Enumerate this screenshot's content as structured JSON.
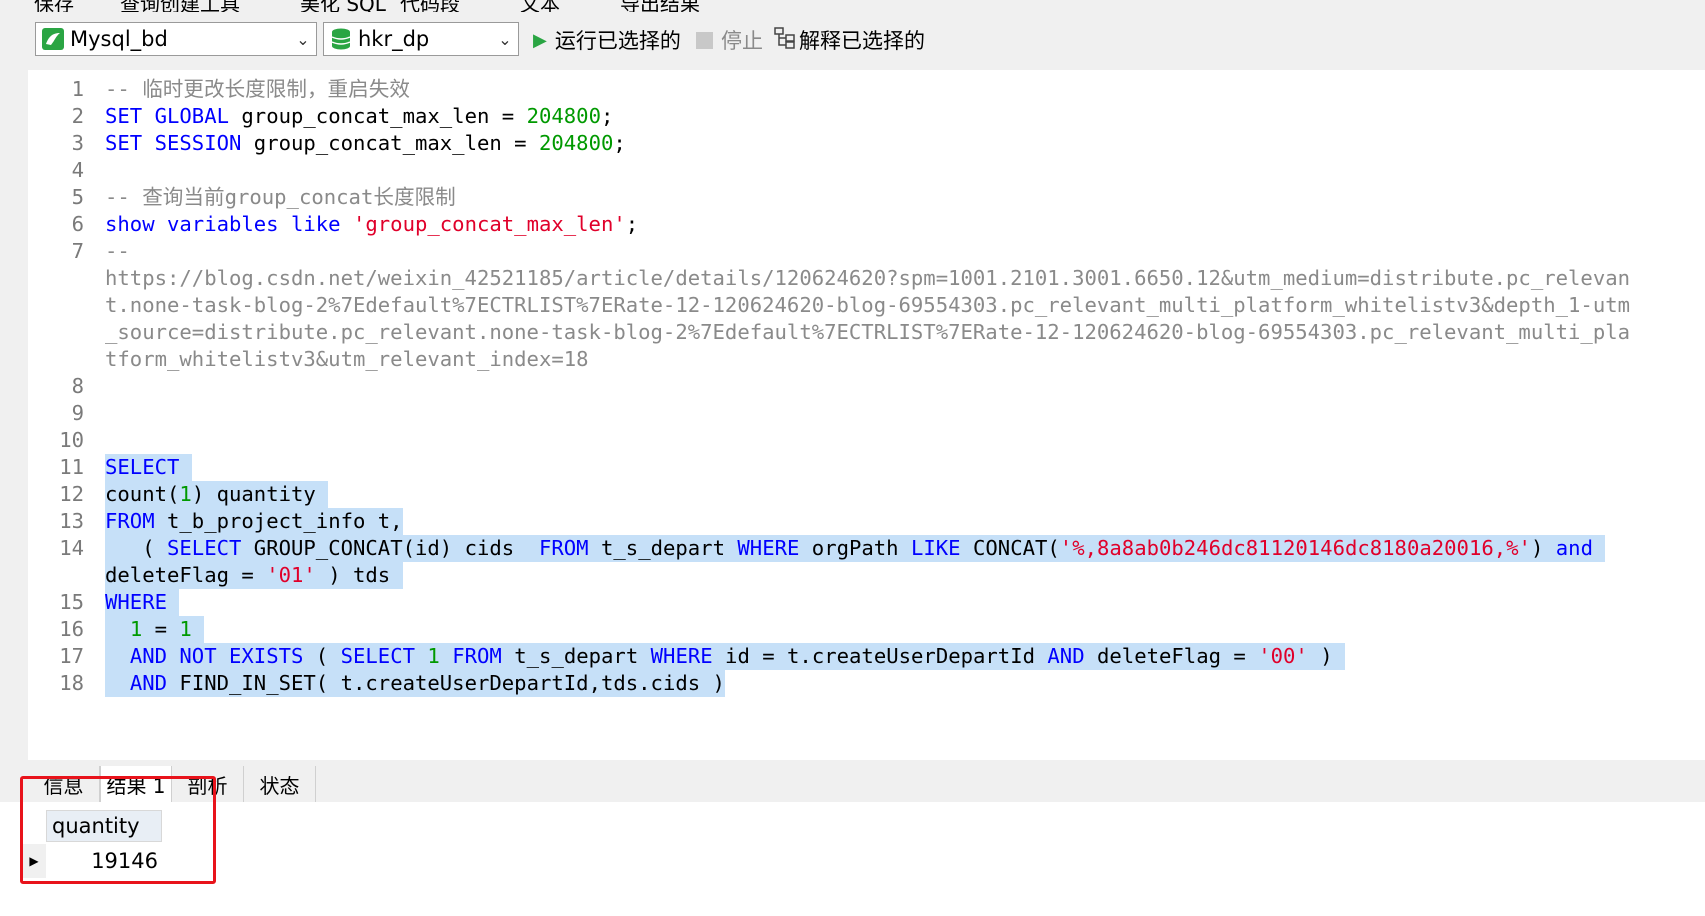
{
  "top_partial": {
    "items": [
      "保存",
      "查询创建工具",
      "美化 SQL",
      "代码段",
      "文本",
      "导出结果"
    ]
  },
  "toolbar": {
    "connection": "Mysql_bd",
    "database": "hkr_dp",
    "run_selected": "运行已选择的",
    "stop": "停止",
    "explain_selected": "解释已选择的"
  },
  "editor": {
    "lines": [
      {
        "n": "1",
        "tokens": [
          {
            "t": "-- 临时更改长度限制，重启失效",
            "c": "cm"
          }
        ]
      },
      {
        "n": "2",
        "tokens": [
          {
            "t": "SET GLOBAL",
            "c": "kw"
          },
          {
            "t": " group_concat_max_len = ",
            "c": ""
          },
          {
            "t": "204800",
            "c": "num"
          },
          {
            "t": ";",
            "c": ""
          }
        ]
      },
      {
        "n": "3",
        "tokens": [
          {
            "t": "SET SESSION",
            "c": "kw"
          },
          {
            "t": " group_concat_max_len = ",
            "c": ""
          },
          {
            "t": "204800",
            "c": "num"
          },
          {
            "t": ";",
            "c": ""
          }
        ]
      },
      {
        "n": "4",
        "tokens": []
      },
      {
        "n": "5",
        "tokens": [
          {
            "t": "-- 查询当前group_concat长度限制",
            "c": "cm"
          }
        ]
      },
      {
        "n": "6",
        "tokens": [
          {
            "t": "show variables like",
            "c": "kw"
          },
          {
            "t": " ",
            "c": ""
          },
          {
            "t": "'group_concat_max_len'",
            "c": "str"
          },
          {
            "t": ";",
            "c": ""
          }
        ]
      },
      {
        "n": "7",
        "tokens": [
          {
            "t": "--",
            "c": "cm"
          }
        ]
      },
      {
        "n": "",
        "tokens": [
          {
            "t": "https://blog.csdn.net/weixin_42521185/article/details/120624620?spm=1001.2101.3001.6650.12&utm_medium=distribute.pc_relevan",
            "c": "cm"
          }
        ]
      },
      {
        "n": "",
        "tokens": [
          {
            "t": "t.none-task-blog-2%7Edefault%7ECTRLIST%7ERate-12-120624620-blog-69554303.pc_relevant_multi_platform_whitelistv3&depth_1-utm",
            "c": "cm"
          }
        ]
      },
      {
        "n": "",
        "tokens": [
          {
            "t": "_source=distribute.pc_relevant.none-task-blog-2%7Edefault%7ECTRLIST%7ERate-12-120624620-blog-69554303.pc_relevant_multi_pla",
            "c": "cm"
          }
        ]
      },
      {
        "n": "",
        "tokens": [
          {
            "t": "tform_whitelistv3&utm_relevant_index=18",
            "c": "cm"
          }
        ]
      },
      {
        "n": "8",
        "tokens": []
      },
      {
        "n": "9",
        "tokens": []
      },
      {
        "n": "10",
        "tokens": []
      },
      {
        "n": "11",
        "sel": true,
        "tokens": [
          {
            "t": "SELECT ",
            "c": "kw"
          }
        ]
      },
      {
        "n": "12",
        "sel": true,
        "tokens": [
          {
            "t": "count(",
            "c": ""
          },
          {
            "t": "1",
            "c": "num"
          },
          {
            "t": ") quantity ",
            "c": ""
          }
        ]
      },
      {
        "n": "13",
        "sel": true,
        "tokens": [
          {
            "t": "FROM",
            "c": "kw"
          },
          {
            "t": " t_b_project_info t,",
            "c": ""
          }
        ]
      },
      {
        "n": "14",
        "sel": true,
        "tokens": [
          {
            "t": "   ( ",
            "c": ""
          },
          {
            "t": "SELECT",
            "c": "kw"
          },
          {
            "t": " GROUP_CONCAT(id) cids  ",
            "c": ""
          },
          {
            "t": "FROM",
            "c": "kw"
          },
          {
            "t": " t_s_depart ",
            "c": ""
          },
          {
            "t": "WHERE",
            "c": "kw"
          },
          {
            "t": " orgPath ",
            "c": ""
          },
          {
            "t": "LIKE",
            "c": "kw"
          },
          {
            "t": " CONCAT(",
            "c": ""
          },
          {
            "t": "'%,8a8ab0b246dc81120146dc8180a20016,%'",
            "c": "str"
          },
          {
            "t": ") ",
            "c": ""
          },
          {
            "t": "and",
            "c": "kw"
          },
          {
            "t": " ",
            "c": ""
          }
        ]
      },
      {
        "n": "",
        "sel": true,
        "tokens": [
          {
            "t": "deleteFlag = ",
            "c": ""
          },
          {
            "t": "'01'",
            "c": "str"
          },
          {
            "t": " ) tds ",
            "c": ""
          }
        ]
      },
      {
        "n": "15",
        "sel": true,
        "tokens": [
          {
            "t": "WHERE ",
            "c": "kw"
          }
        ]
      },
      {
        "n": "16",
        "sel": true,
        "tokens": [
          {
            "t": "  ",
            "c": ""
          },
          {
            "t": "1",
            "c": "num"
          },
          {
            "t": " = ",
            "c": ""
          },
          {
            "t": "1",
            "c": "num"
          },
          {
            "t": " ",
            "c": ""
          }
        ]
      },
      {
        "n": "17",
        "sel": true,
        "tokens": [
          {
            "t": "  ",
            "c": ""
          },
          {
            "t": "AND NOT EXISTS",
            "c": "kw"
          },
          {
            "t": " ( ",
            "c": ""
          },
          {
            "t": "SELECT",
            "c": "kw"
          },
          {
            "t": " ",
            "c": ""
          },
          {
            "t": "1",
            "c": "num"
          },
          {
            "t": " ",
            "c": ""
          },
          {
            "t": "FROM",
            "c": "kw"
          },
          {
            "t": " t_s_depart ",
            "c": ""
          },
          {
            "t": "WHERE",
            "c": "kw"
          },
          {
            "t": " id = t.createUserDepartId ",
            "c": ""
          },
          {
            "t": "AND",
            "c": "kw"
          },
          {
            "t": " deleteFlag = ",
            "c": ""
          },
          {
            "t": "'00'",
            "c": "str"
          },
          {
            "t": " ) ",
            "c": ""
          }
        ]
      },
      {
        "n": "18",
        "sel": true,
        "tokens": [
          {
            "t": "  ",
            "c": ""
          },
          {
            "t": "AND",
            "c": "kw"
          },
          {
            "t": " FIND_IN_SET( t.createUserDepartId,tds.cids )",
            "c": ""
          }
        ]
      }
    ]
  },
  "tabs": [
    {
      "label": "信息",
      "active": false
    },
    {
      "label": "结果 1",
      "active": true
    },
    {
      "label": "剖析",
      "active": false
    },
    {
      "label": "状态",
      "active": false
    }
  ],
  "result": {
    "column": "quantity",
    "value": "19146"
  },
  "colors": {
    "keyword": "#0000ff",
    "number": "#009900",
    "string": "#e0002a",
    "comment": "#8a8a8a",
    "selection": "#c6e0f8",
    "highlight_box": "#e8131b"
  }
}
